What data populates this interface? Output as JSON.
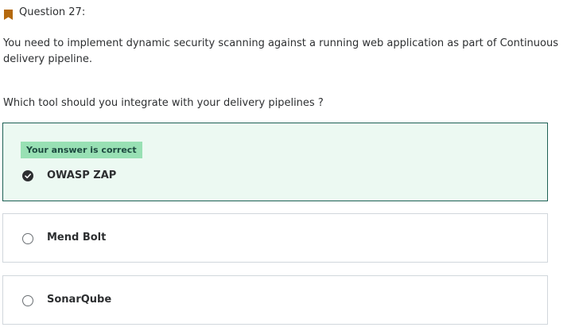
{
  "question": {
    "title": "Question 27:",
    "body": "You need to implement dynamic security scanning against a running web application as part of Continuous delivery pipeline.",
    "prompt": "Which tool should you integrate with your delivery pipelines ?"
  },
  "feedback": {
    "correct_label": "Your answer is correct"
  },
  "options": [
    {
      "label": "OWASP ZAP",
      "selected": true,
      "correct": true
    },
    {
      "label": "Mend Bolt",
      "selected": false,
      "correct": false
    },
    {
      "label": "SonarQube",
      "selected": false,
      "correct": false
    }
  ],
  "icons": {
    "flag": "bookmark-flag-icon",
    "check": "checkmark-icon"
  },
  "colors": {
    "flag": "#b4690e",
    "correct_bg": "#ecf9f2",
    "correct_border": "#1e6055",
    "badge_bg": "#98e0b4",
    "text": "#2d2f31"
  }
}
